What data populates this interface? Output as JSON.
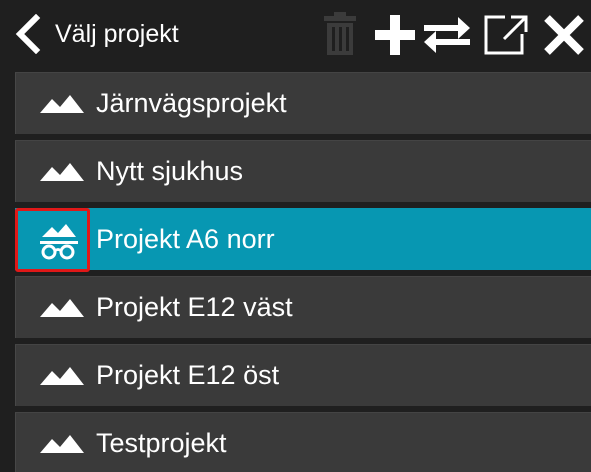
{
  "header": {
    "title": "Välj projekt",
    "icons": {
      "back": "chevron-left-icon",
      "trash": "trash-icon",
      "add": "plus-icon",
      "swap": "swap-arrows-icon",
      "open": "open-external-icon",
      "close": "close-icon"
    }
  },
  "projects": {
    "items": [
      {
        "label": "Järnvägsprojekt",
        "icon": "mountain-icon",
        "selected": false
      },
      {
        "label": "Nytt sjukhus",
        "icon": "mountain-icon",
        "selected": false
      },
      {
        "label": "Projekt A6 norr",
        "icon": "mountain-glasses-icon",
        "selected": true
      },
      {
        "label": "Projekt E12 väst",
        "icon": "mountain-icon",
        "selected": false
      },
      {
        "label": "Projekt E12 öst",
        "icon": "mountain-icon",
        "selected": false
      },
      {
        "label": "Testprojekt",
        "icon": "mountain-icon",
        "selected": false
      }
    ]
  },
  "colors": {
    "background": "#1f1f1f",
    "item": "#3a3a3a",
    "selected": "#0797b2",
    "highlight": "#e01818",
    "icon_disabled": "#3b3b3b",
    "text": "#ffffff"
  }
}
